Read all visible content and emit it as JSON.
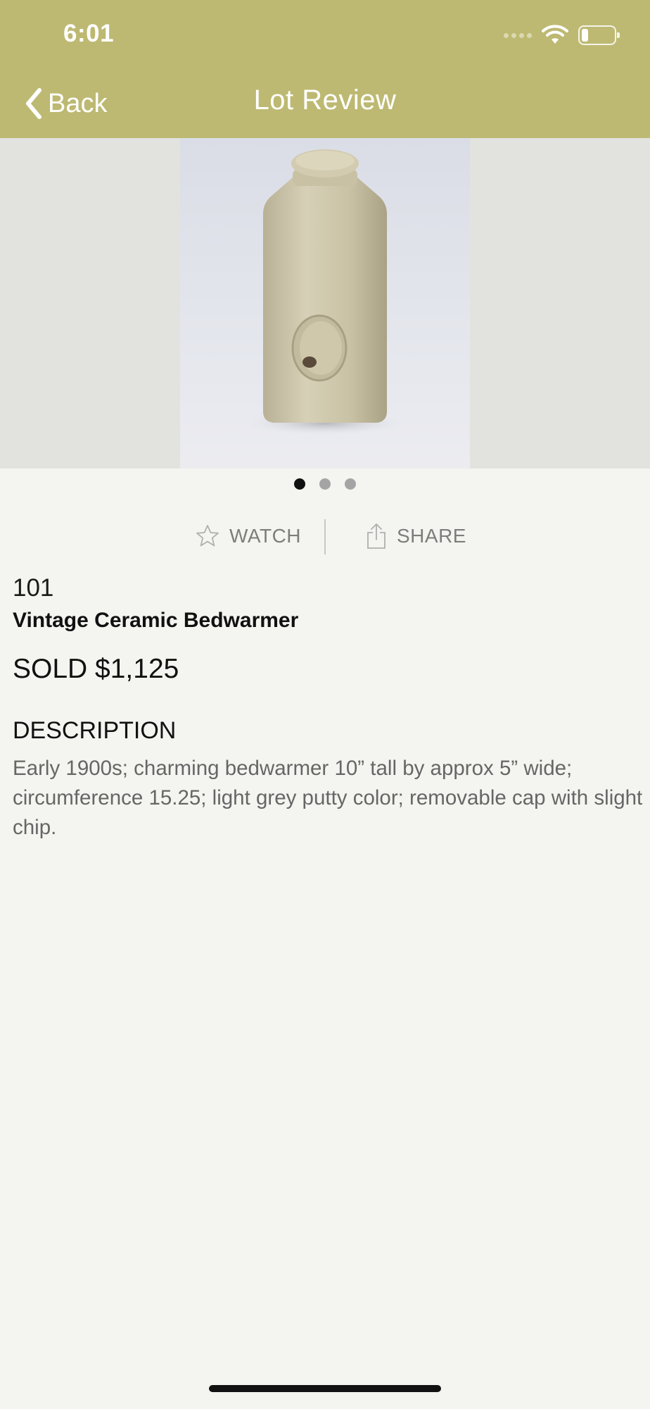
{
  "status_bar": {
    "time": "6:01",
    "icons": [
      "cellular-signal-icon",
      "wifi-icon",
      "battery-icon"
    ]
  },
  "nav": {
    "back_label": "Back",
    "title": "Lot Review"
  },
  "gallery": {
    "image_count": 3,
    "active_index": 0
  },
  "actions": {
    "watch_label": "WATCH",
    "share_label": "SHARE"
  },
  "lot": {
    "number": "101",
    "title": "Vintage Ceramic Bedwarmer",
    "price": "SOLD $1,125",
    "description_heading": "DESCRIPTION",
    "description": "Early 1900s; charming bedwarmer 10” tall by approx 5” wide; circumference 15.25; light grey putty color; removable cap with slight chip."
  },
  "colors": {
    "header": "#bdb972",
    "background": "#f4f4f0",
    "muted_text": "#7d7d7d"
  }
}
